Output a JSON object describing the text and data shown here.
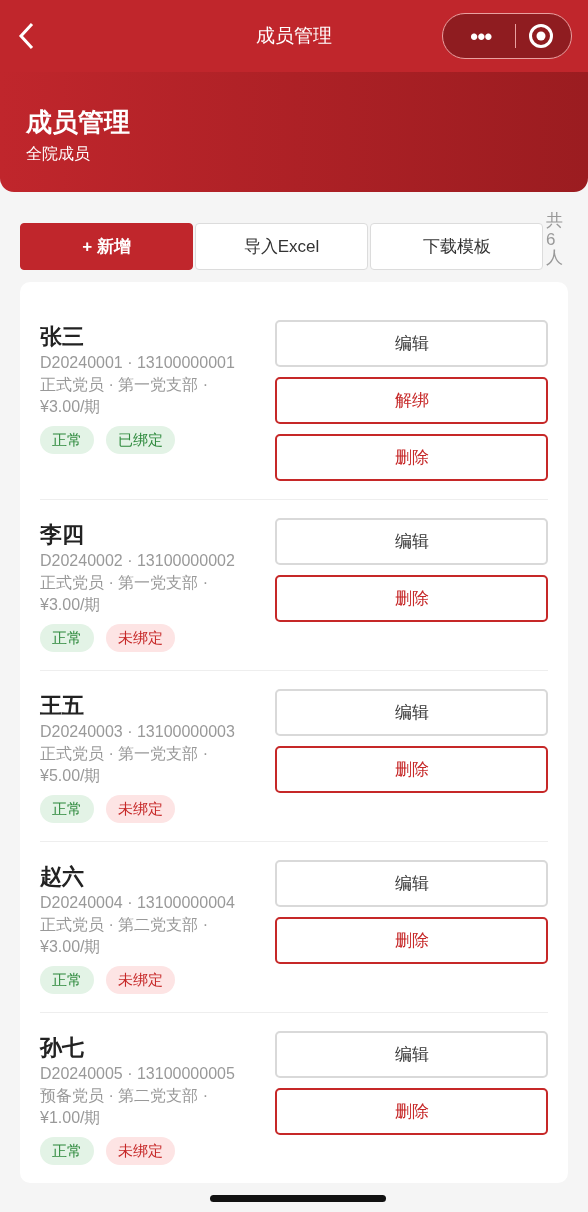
{
  "nav": {
    "title": "成员管理",
    "more": "•••"
  },
  "header": {
    "title": "成员管理",
    "subtitle": "全院成员"
  },
  "toolbar": {
    "buttons": [
      {
        "label": "+ 新增",
        "selected": true
      },
      {
        "label": "导入Excel",
        "selected": false
      },
      {
        "label": "下载模板",
        "selected": false
      }
    ],
    "count": "共6人"
  },
  "members": [
    {
      "name": "张三",
      "ids": "D20240001 · 13100000001",
      "info": "正式党员 · 第一党支部 · ¥3.00/期",
      "tags": [
        {
          "label": "正常",
          "kind": "ok"
        },
        {
          "label": "已绑定",
          "kind": "ok"
        }
      ],
      "buttons": [
        {
          "label": "编辑",
          "kind": "edit"
        },
        {
          "label": "解绑",
          "kind": "danger"
        },
        {
          "label": "删除",
          "kind": "danger"
        }
      ]
    },
    {
      "name": "李四",
      "ids": "D20240002 · 13100000002",
      "info": "正式党员 · 第一党支部 · ¥3.00/期",
      "tags": [
        {
          "label": "正常",
          "kind": "ok"
        },
        {
          "label": "未绑定",
          "kind": "warn"
        }
      ],
      "buttons": [
        {
          "label": "编辑",
          "kind": "edit"
        },
        {
          "label": "删除",
          "kind": "danger"
        }
      ]
    },
    {
      "name": "王五",
      "ids": "D20240003 · 13100000003",
      "info": "正式党员 · 第一党支部 · ¥5.00/期",
      "tags": [
        {
          "label": "正常",
          "kind": "ok"
        },
        {
          "label": "未绑定",
          "kind": "warn"
        }
      ],
      "buttons": [
        {
          "label": "编辑",
          "kind": "edit"
        },
        {
          "label": "删除",
          "kind": "danger"
        }
      ]
    },
    {
      "name": "赵六",
      "ids": "D20240004 · 13100000004",
      "info": "正式党员 · 第二党支部 · ¥3.00/期",
      "tags": [
        {
          "label": "正常",
          "kind": "ok"
        },
        {
          "label": "未绑定",
          "kind": "warn"
        }
      ],
      "buttons": [
        {
          "label": "编辑",
          "kind": "edit"
        },
        {
          "label": "删除",
          "kind": "danger"
        }
      ]
    },
    {
      "name": "孙七",
      "ids": "D20240005 · 13100000005",
      "info": "预备党员 · 第二党支部 · ¥1.00/期",
      "tags": [
        {
          "label": "正常",
          "kind": "ok"
        },
        {
          "label": "未绑定",
          "kind": "warn"
        }
      ],
      "buttons": [
        {
          "label": "编辑",
          "kind": "edit"
        },
        {
          "label": "删除",
          "kind": "danger"
        }
      ]
    }
  ]
}
